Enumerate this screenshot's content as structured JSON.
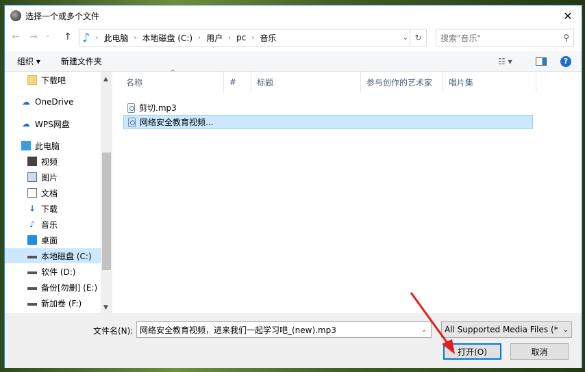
{
  "window": {
    "title": "选择一个或多个文件",
    "close": "✕"
  },
  "nav": {
    "back": "←",
    "forward": "→",
    "recent": "⌄",
    "up": "↑"
  },
  "breadcrumb": [
    "此电脑",
    "本地磁盘 (C:)",
    "用户",
    "pc",
    "音乐"
  ],
  "search": {
    "placeholder": "搜索\"音乐\""
  },
  "toolbar": {
    "organize": "组织 ▾",
    "new_folder": "新建文件夹"
  },
  "sidebar": [
    {
      "label": "下载吧",
      "icon": "folder"
    },
    {
      "label": "OneDrive",
      "icon": "cloud"
    },
    {
      "label": "WPS网盘",
      "icon": "cloud"
    },
    {
      "label": "此电脑",
      "icon": "computer"
    },
    {
      "label": "视频",
      "icon": "video"
    },
    {
      "label": "图片",
      "icon": "picture"
    },
    {
      "label": "文档",
      "icon": "document"
    },
    {
      "label": "下载",
      "icon": "download"
    },
    {
      "label": "音乐",
      "icon": "music"
    },
    {
      "label": "桌面",
      "icon": "desktop"
    },
    {
      "label": "本地磁盘 (C:)",
      "icon": "drive"
    },
    {
      "label": "软件 (D:)",
      "icon": "drive"
    },
    {
      "label": "备份[勿删] (E:)",
      "icon": "drive"
    },
    {
      "label": "新加卷 (F:)",
      "icon": "drive"
    }
  ],
  "columns": [
    "名称",
    "#",
    "标题",
    "参与创作的艺术家",
    "唱片集"
  ],
  "files": [
    {
      "name": "剪切.mp3"
    },
    {
      "name": "网络安全教育视频..."
    }
  ],
  "bottom": {
    "filename_label": "文件名(N):",
    "filename_value": "网络安全教育视频，进来我们一起学习吧_(new).mp3",
    "filetype": "All Supported Media Files (*",
    "open": "打开(O)",
    "cancel": "取消"
  },
  "colors": {
    "accent": "#0078d7",
    "selection": "#cce8ff",
    "arrow": "#e02020"
  }
}
